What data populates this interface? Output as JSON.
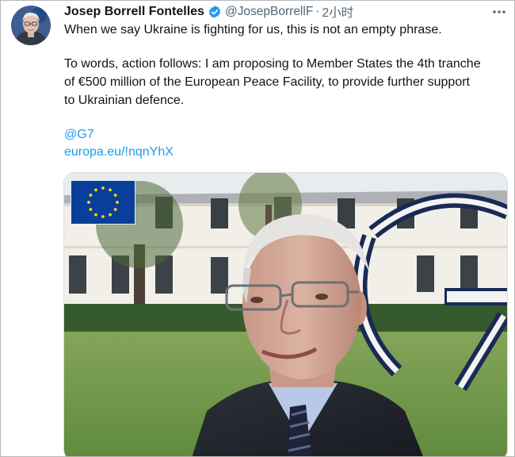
{
  "tweet": {
    "author_name": "Josep Borrell Fontelles",
    "handle": "@JosepBorrellF",
    "separator": "·",
    "time": "2小时",
    "icons": {
      "avatar": "avatar-photo",
      "verified": "verified-badge-icon",
      "more": "more-options-icon"
    },
    "lines": [
      "When we say Ukraine is fighting for us, this is not an empty phrase.",
      "To words, action follows: I am proposing to Member States the 4th tranche",
      "of €500 million of the European Peace Facility, to provide further support",
      "to Ukrainian defence."
    ],
    "mention": "@G7",
    "url": "europa.eu/!nqnYhX"
  },
  "media": {
    "type": "video",
    "overlay_logo": "eu-flag"
  },
  "colors": {
    "link": "#1d9bf0",
    "verified": "#1d9bf0",
    "text": "#0f1419",
    "secondary": "#536471",
    "eu_blue": "#0a3f99",
    "eu_gold": "#ffd617"
  }
}
